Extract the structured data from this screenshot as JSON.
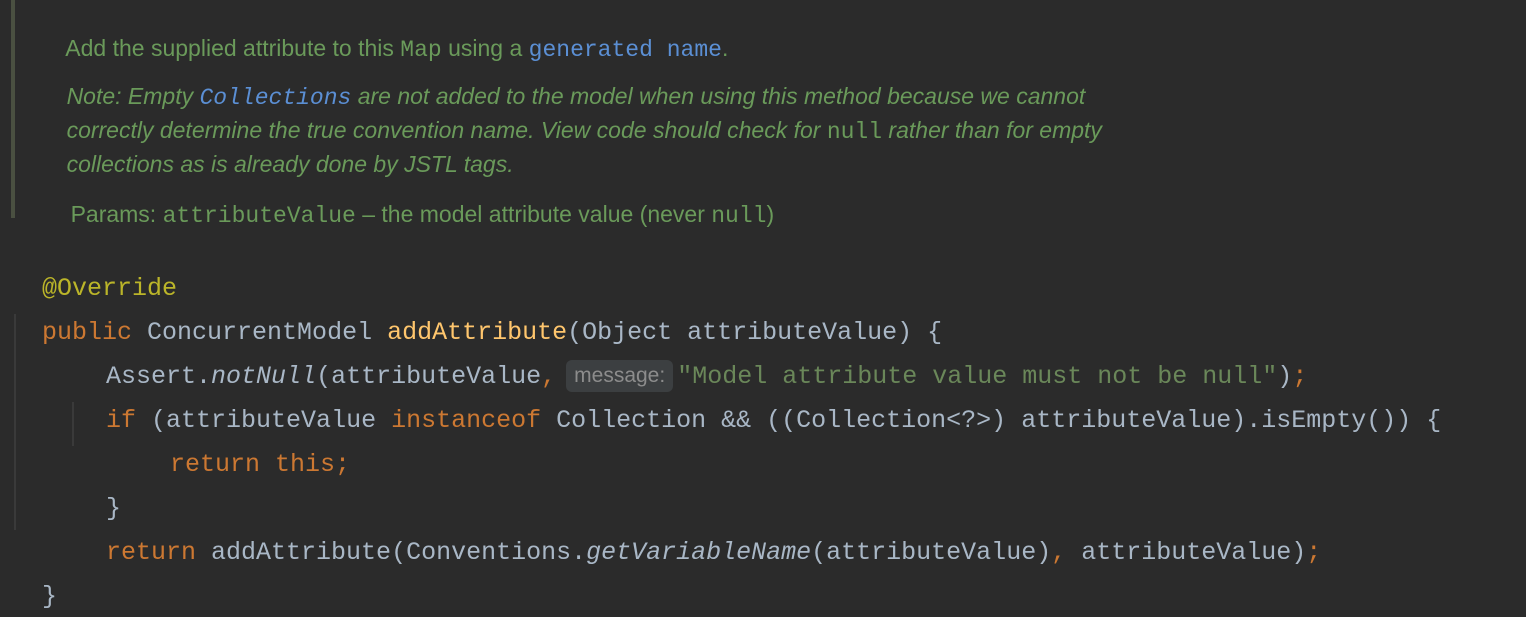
{
  "doc": {
    "line1_pre": "Add the supplied attribute to this ",
    "line1_map": "Map",
    "line1_mid": " using a ",
    "line1_link1": "generated",
    "line1_link2": "name",
    "line1_end": ".",
    "note1_pre": "Note: Empty ",
    "note1_link": "Collections",
    "note1_post": " are not added to the model when using this method because we cannot",
    "note2_pre": "correctly determine the true convention name. View code should check for ",
    "note2_code": "null",
    "note2_post": " rather than for empty",
    "note3": "collections as is already done by JSTL tags.",
    "params_label": "Params:",
    "params_name": "attributeValue",
    "params_desc": " – the model attribute value (never ",
    "params_null": "null",
    "params_end": ")"
  },
  "code": {
    "annotation": "@Override",
    "l2_public": "public",
    "l2_type": " ConcurrentModel ",
    "l2_method": "addAttribute",
    "l2_params": "(Object attributeValue) {",
    "l3_assert": "Assert.",
    "l3_notnull": "notNull",
    "l3_args": "(attributeValue",
    "l3_comma": ",",
    "l3_hint": "message:",
    "l3_string": "\"Model attribute value must not be null\"",
    "l3_close": ")",
    "l3_semi": ";",
    "l4_if": "if",
    "l4_a": " (attributeValue ",
    "l4_instanceof": "instanceof",
    "l4_b": " Collection && ((Collection<?>) attributeValue).isEmpty()) {",
    "l5_return": "return",
    "l5_this": " this",
    "l5_semi": ";",
    "l6": "}",
    "l7_return": "return",
    "l7_a": " addAttribute(Conventions.",
    "l7_getvar": "getVariableName",
    "l7_b": "(attributeValue)",
    "l7_comma": ",",
    "l7_c": " attributeValue)",
    "l7_semi": ";",
    "l8": "}"
  }
}
